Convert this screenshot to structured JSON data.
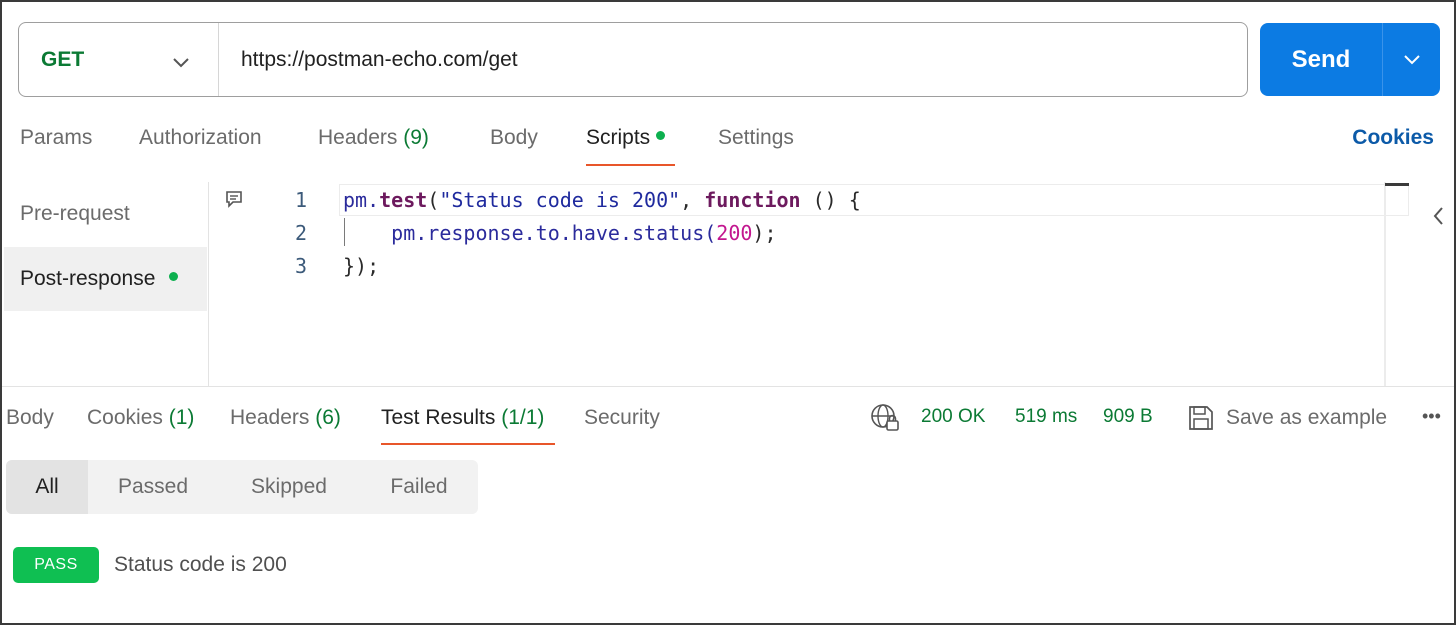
{
  "request": {
    "method": "GET",
    "url": "https://postman-echo.com/get",
    "send_label": "Send"
  },
  "request_tabs": {
    "params": "Params",
    "authorization": "Authorization",
    "headers": "Headers",
    "headers_count": "(9)",
    "body": "Body",
    "scripts": "Scripts",
    "settings": "Settings",
    "cookies": "Cookies"
  },
  "script_sidebar": {
    "pre_request": "Pre-request",
    "post_response": "Post-response"
  },
  "editor": {
    "line_numbers": [
      "1",
      "2",
      "3"
    ],
    "line1": {
      "a": "pm.",
      "b": "test",
      "c": "(",
      "d": "\"Status code is 200\"",
      "e": ", ",
      "f": "function",
      "g": " () {"
    },
    "line2": {
      "a": "    pm.response.to.have.status(",
      "b": "200",
      "c": ");"
    },
    "line3": "});"
  },
  "response_tabs": {
    "body": "Body",
    "cookies": "Cookies",
    "cookies_count": "(1)",
    "headers": "Headers",
    "headers_count": "(6)",
    "test_results": "Test Results",
    "test_results_count": "(1/1)",
    "security": "Security"
  },
  "response_meta": {
    "status": "200 OK",
    "time": "519 ms",
    "size": "909 B",
    "save_example": "Save as example",
    "more": "•••"
  },
  "filters": [
    "All",
    "Passed",
    "Skipped",
    "Failed"
  ],
  "test_result": {
    "badge": "PASS",
    "name": "Status code is 200"
  },
  "colors": {
    "accent_blue": "#0c7be3",
    "method_green": "#0b7a34",
    "pass_green": "#0fbf52",
    "active_tab_underline": "#e8562a"
  },
  "icons": [
    "chevron-down-icon",
    "chevron-left-icon",
    "comment-icon",
    "globe-lock-icon",
    "save-icon",
    "more-icon"
  ]
}
